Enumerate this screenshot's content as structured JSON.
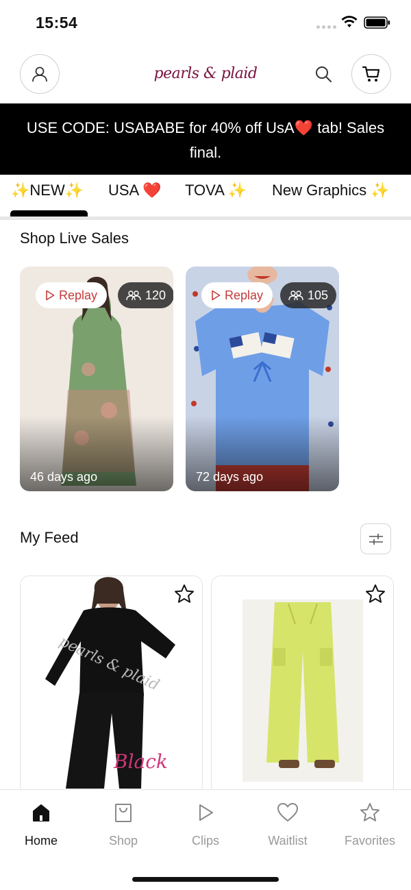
{
  "status": {
    "time": "15:54"
  },
  "header": {
    "logo_text": "pearls & plaid",
    "icons": [
      "person-icon",
      "search-icon",
      "cart-icon"
    ]
  },
  "promo": {
    "text": "USE CODE: USABABE for 40% off UsA❤️ tab! Sales final."
  },
  "tabs": [
    {
      "label": "✨NEW✨",
      "active": true
    },
    {
      "label": "USA ❤️",
      "active": false
    },
    {
      "label": "TOVA ✨",
      "active": false
    },
    {
      "label": "New Graphics ✨",
      "active": false
    }
  ],
  "live": {
    "title": "Shop Live Sales",
    "cards": [
      {
        "replay_label": "Replay",
        "viewers": "120",
        "age": "46 days ago"
      },
      {
        "replay_label": "Replay",
        "viewers": "105",
        "age": "72 days ago"
      }
    ]
  },
  "feed": {
    "title": "My Feed",
    "products": [
      {
        "watermark": "pearls & plaid",
        "color_label": "Black"
      },
      {
        "color_label": ""
      }
    ]
  },
  "nav": [
    {
      "label": "Home",
      "icon": "home-icon",
      "active": true
    },
    {
      "label": "Shop",
      "icon": "shop-bag-icon",
      "active": false
    },
    {
      "label": "Clips",
      "icon": "play-icon",
      "active": false
    },
    {
      "label": "Waitlist",
      "icon": "heart-icon",
      "active": false
    },
    {
      "label": "Favorites",
      "icon": "star-icon",
      "active": false
    }
  ],
  "colors": {
    "logo": "#7a1240",
    "promo_bg": "#000000",
    "replay_text": "#c43a3a",
    "inactive_nav": "#999999"
  }
}
